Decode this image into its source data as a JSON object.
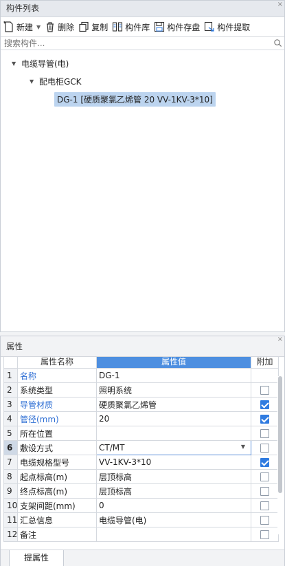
{
  "component_panel": {
    "title": "构件列表",
    "toolbar": {
      "new_label": "新建",
      "delete_label": "删除",
      "copy_label": "复制",
      "library_label": "构件库",
      "save_label": "构件存盘",
      "extract_label": "构件提取"
    },
    "search_placeholder": "搜索构件...",
    "tree": {
      "level1": "电缆导管(电)",
      "level2": "配电柜GCK",
      "selected_item": "DG-1 [硬质聚氯乙烯管 20 VV-1KV-3*10]"
    }
  },
  "properties_panel": {
    "title": "属性",
    "headers": {
      "name": "属性名称",
      "value": "属性值",
      "extra": "附加"
    },
    "rows": [
      {
        "num": "1",
        "name": "名称",
        "value": "DG-1",
        "checked": null,
        "blue": true
      },
      {
        "num": "2",
        "name": "系统类型",
        "value": "照明系统",
        "checked": false,
        "blue": false
      },
      {
        "num": "3",
        "name": "导管材质",
        "value": "硬质聚氯乙烯管",
        "checked": true,
        "blue": true
      },
      {
        "num": "4",
        "name": "管径(mm)",
        "value": "20",
        "checked": true,
        "blue": true
      },
      {
        "num": "5",
        "name": "所在位置",
        "value": "",
        "checked": false,
        "blue": false
      },
      {
        "num": "6",
        "name": "敷设方式",
        "value": "CT/MT",
        "checked": false,
        "blue": false
      },
      {
        "num": "7",
        "name": "电缆规格型号",
        "value": "VV-1KV-3*10",
        "checked": true,
        "blue": false
      },
      {
        "num": "8",
        "name": "起点标高(m)",
        "value": "层顶标高",
        "checked": false,
        "blue": false
      },
      {
        "num": "9",
        "name": "终点标高(m)",
        "value": "层顶标高",
        "checked": false,
        "blue": false
      },
      {
        "num": "10",
        "name": "支架间距(mm)",
        "value": "0",
        "checked": false,
        "blue": false
      },
      {
        "num": "11",
        "name": "汇总信息",
        "value": "电缆导管(电)",
        "checked": false,
        "blue": false
      },
      {
        "num": "12",
        "name": "备注",
        "value": "",
        "checked": false,
        "blue": false
      }
    ],
    "bottom_tab": "提属性"
  }
}
